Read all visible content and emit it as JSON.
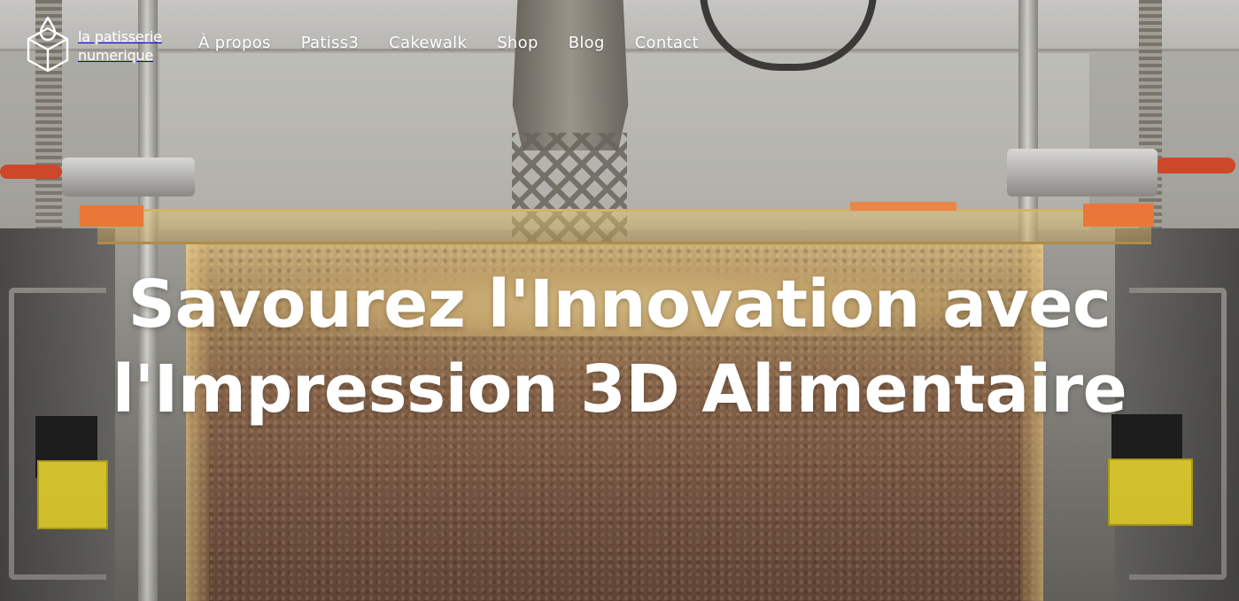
{
  "brand": {
    "logo_icon": "cube-drop-icon",
    "name_line1": "la patisserie",
    "name_line2": "numerique"
  },
  "nav": {
    "items": [
      {
        "label": "À propos"
      },
      {
        "label": "Patiss3"
      },
      {
        "label": "Cakewalk"
      },
      {
        "label": "Shop"
      },
      {
        "label": "Blog"
      },
      {
        "label": "Contact"
      }
    ]
  },
  "hero": {
    "title_line1": "Savourez l'Innovation avec",
    "title_line2": "l'Impression 3D Alimentaire"
  },
  "colors": {
    "text": "#ffffff",
    "accent_orange": "#f07a3a",
    "clamp_red": "#d34a2a",
    "block_yellow": "#e6d230"
  }
}
